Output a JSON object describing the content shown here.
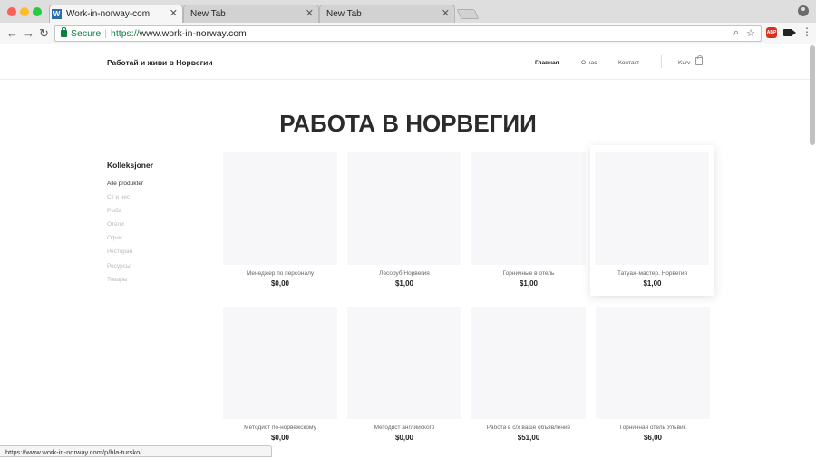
{
  "browser": {
    "tabs": [
      {
        "title": "Work-in-norway-com",
        "favicon": "W",
        "active": true
      },
      {
        "title": "New Tab",
        "active": false
      },
      {
        "title": "New Tab",
        "active": false
      }
    ],
    "close_glyph": "✕",
    "secure_label": "Secure",
    "url_scheme": "https://",
    "url_host": "www.work-in-norway.com",
    "abp_label": "ABP",
    "status_url": "https://www.work-in-norway.com/p/bla-tursko/"
  },
  "site": {
    "brand": "Работай и живи в Норвегии",
    "nav": [
      "Главная",
      "О нас",
      "Контакт"
    ],
    "cart_label": "Kurv",
    "page_title": "РАБОТА В НОРВЕГИИ",
    "collections_title": "Kolleksjoner",
    "collections": [
      "Alle produkter",
      "Cli и нес",
      "Рыба",
      "Отели",
      "Офис",
      "Ресторан",
      "Ресурсы",
      "Товары"
    ],
    "products": [
      {
        "name": "Менеджер по персоналу",
        "price": "$0,00"
      },
      {
        "name": "Лесоруб Норвегия",
        "price": "$1,00"
      },
      {
        "name": "Горничные в отель",
        "price": "$1,00"
      },
      {
        "name": "Татуаж-мастер. Норвегия",
        "price": "$1,00"
      },
      {
        "name": "Методист по-норвежскому",
        "price": "$0,00"
      },
      {
        "name": "Методист английского",
        "price": "$0,00"
      },
      {
        "name": "Работа в с/х ваше объявление",
        "price": "$51,00"
      },
      {
        "name": "Горничная отель Ульвик",
        "price": "$6,00"
      }
    ]
  }
}
